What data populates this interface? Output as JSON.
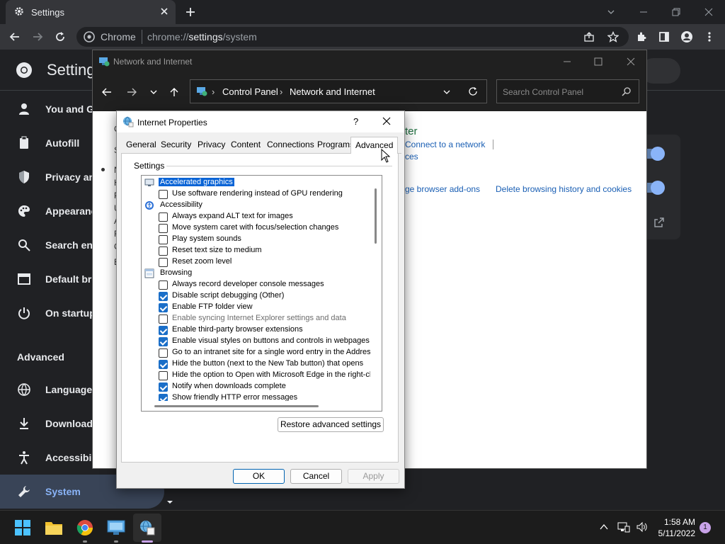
{
  "chrome": {
    "tab_title": "Settings",
    "omnibox_site": "Chrome",
    "url_prefix": "chrome://",
    "url_host": "settings",
    "url_path": "/system",
    "page_title": "Settings",
    "sidebar": [
      {
        "label": "You and Google",
        "icon": "person-icon"
      },
      {
        "label": "Autofill",
        "icon": "clipboard-icon"
      },
      {
        "label": "Privacy and security",
        "icon": "shield-icon"
      },
      {
        "label": "Appearance",
        "icon": "palette-icon"
      },
      {
        "label": "Search engine",
        "icon": "search-icon"
      },
      {
        "label": "Default browser",
        "icon": "browser-icon"
      },
      {
        "label": "On startup",
        "icon": "power-icon"
      }
    ],
    "advanced_heading": "Advanced",
    "advanced_items": [
      {
        "label": "Languages",
        "icon": "globe-icon"
      },
      {
        "label": "Downloads",
        "icon": "download-icon"
      },
      {
        "label": "Accessibility",
        "icon": "accessibility-icon"
      },
      {
        "label": "System",
        "icon": "wrench-icon"
      }
    ]
  },
  "control_panel": {
    "window_title": "Network and Internet",
    "breadcrumb": [
      "Control Panel",
      "Network and Internet"
    ],
    "search_placeholder": "Search Control Panel",
    "heading_fragment": "ter",
    "link_connect": "Connect to a network",
    "link_ces": "ces",
    "link_addons": "ge browser add-ons",
    "link_delete": "Delete browsing history and cookies",
    "left_letters": [
      "C",
      "S",
      "N",
      "H",
      "P",
      "U",
      "A",
      "F",
      "C",
      "E"
    ]
  },
  "dialog": {
    "title": "Internet Properties",
    "help": "?",
    "tabs": [
      "General",
      "Security",
      "Privacy",
      "Content",
      "Connections",
      "Programs",
      "Advanced"
    ],
    "active_tab": "Advanced",
    "group_label": "Settings",
    "rows": [
      {
        "type": "group",
        "text": "Accelerated graphics",
        "selected": true,
        "icon": "monitor-icon"
      },
      {
        "type": "item",
        "text": "Use software rendering instead of GPU rendering",
        "checked": false
      },
      {
        "type": "group",
        "text": "Accessibility",
        "selected": false,
        "icon": "accessibility-globe-icon"
      },
      {
        "type": "item",
        "text": "Always expand ALT text for images",
        "checked": false
      },
      {
        "type": "item",
        "text": "Move system caret with focus/selection changes",
        "checked": false
      },
      {
        "type": "item",
        "text": "Play system sounds",
        "checked": false
      },
      {
        "type": "item",
        "text": "Reset text size to medium",
        "checked": false
      },
      {
        "type": "item",
        "text": "Reset zoom level",
        "checked": false
      },
      {
        "type": "group",
        "text": "Browsing",
        "selected": false,
        "icon": "window-icon"
      },
      {
        "type": "item",
        "text": "Always record developer console messages",
        "checked": false
      },
      {
        "type": "item",
        "text": "Disable script debugging (Other)",
        "checked": true
      },
      {
        "type": "item",
        "text": "Enable FTP folder view",
        "checked": true
      },
      {
        "type": "item",
        "text": "Enable syncing Internet Explorer settings and data",
        "checked": false,
        "dim": true
      },
      {
        "type": "item",
        "text": "Enable third-party browser extensions",
        "checked": true
      },
      {
        "type": "item",
        "text": "Enable visual styles on buttons and controls in webpages",
        "checked": true
      },
      {
        "type": "item",
        "text": "Go to an intranet site for a single word entry in the Addres",
        "checked": false
      },
      {
        "type": "item",
        "text": "Hide the button (next to the New Tab button) that opens",
        "checked": true
      },
      {
        "type": "item",
        "text": "Hide the option to Open with Microsoft Edge in the right-cl",
        "checked": false
      },
      {
        "type": "item",
        "text": "Notify when downloads complete",
        "checked": true
      },
      {
        "type": "item",
        "text": "Show friendly HTTP error messages",
        "checked": true
      }
    ],
    "restore_button": "Restore advanced settings",
    "ok_button": "OK",
    "cancel_button": "Cancel",
    "apply_button": "Apply"
  },
  "taskbar": {
    "time": "1:58 AM",
    "date": "5/11/2022",
    "notification_count": "1"
  }
}
